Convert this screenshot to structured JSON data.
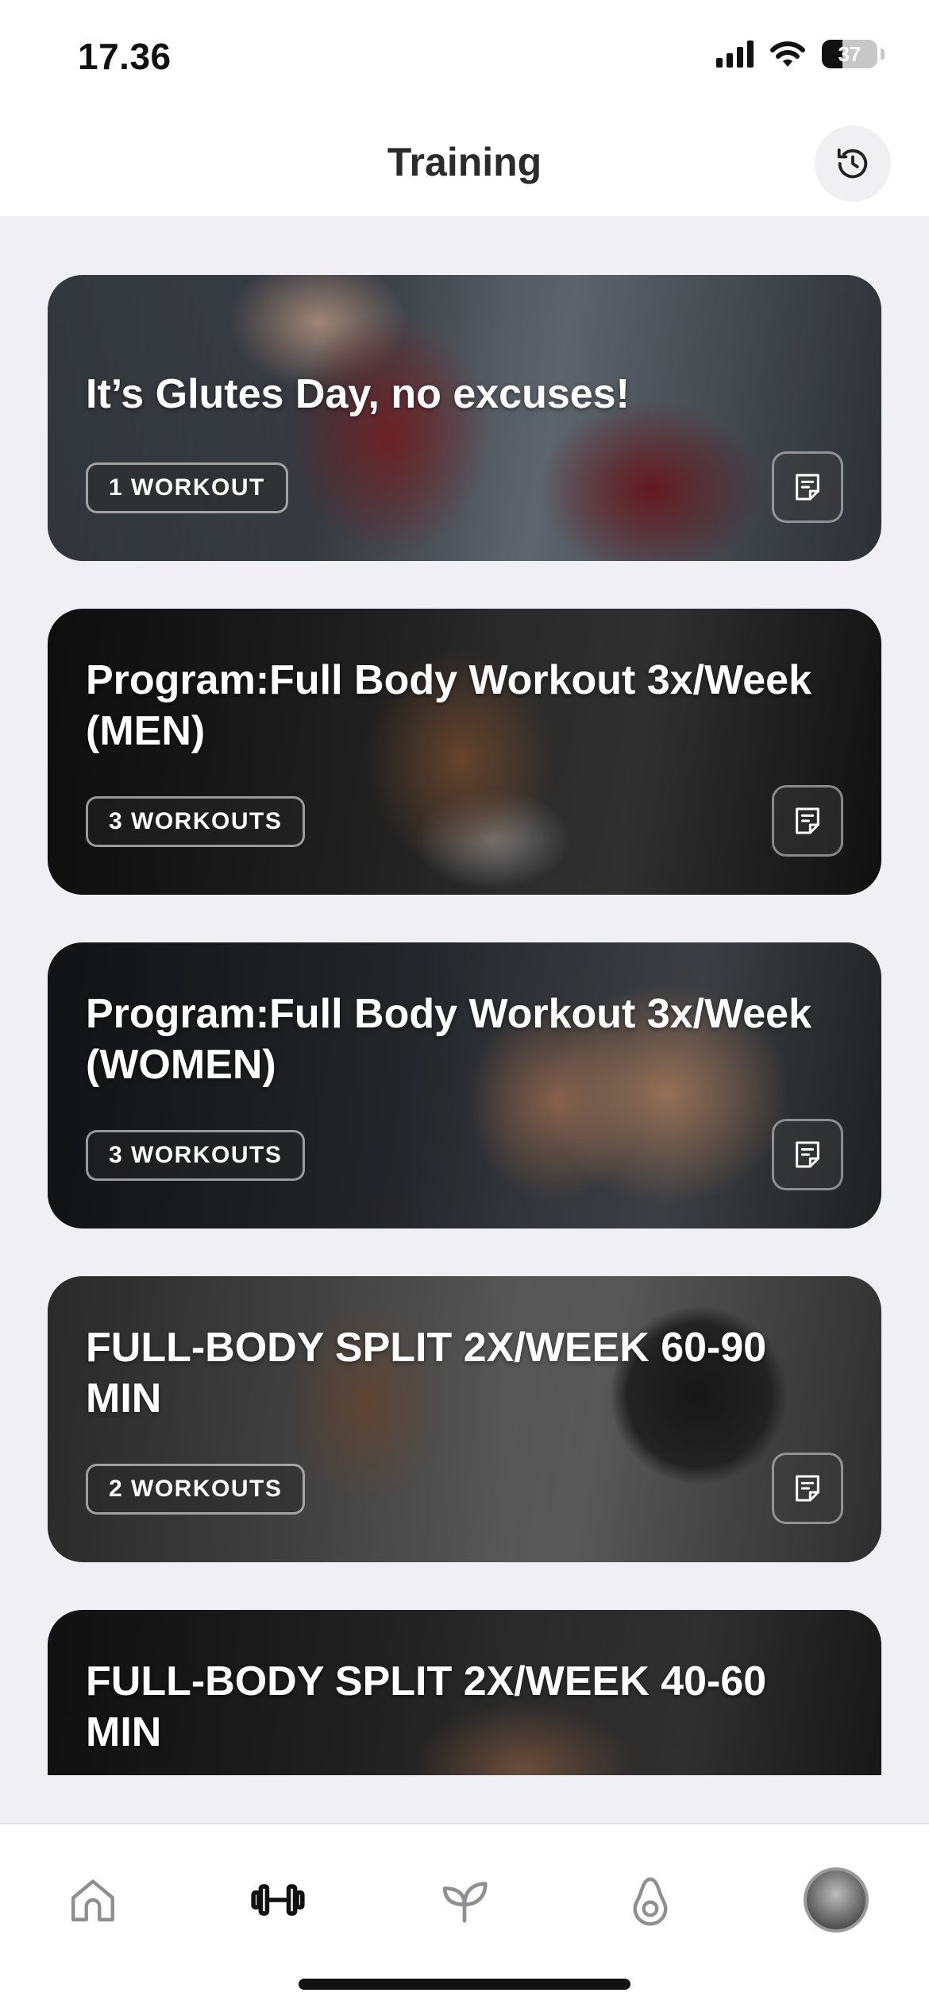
{
  "status_bar": {
    "time": "17.36",
    "battery": "37"
  },
  "header": {
    "title": "Training"
  },
  "cards": [
    {
      "title": "It’s Glutes Day, no excuses!",
      "badge": "1 WORKOUT"
    },
    {
      "title": "Program:Full Body Workout 3x/Week (MEN)",
      "badge": "3 WORKOUTS"
    },
    {
      "title": "Program:Full Body Workout 3x/Week (WOMEN)",
      "badge": "3 WORKOUTS"
    },
    {
      "title": "FULL-BODY SPLIT 2X/WEEK 60-90 MIN",
      "badge": "2 WORKOUTS"
    },
    {
      "title": "FULL-BODY SPLIT 2X/WEEK 40-60 MIN"
    }
  ],
  "tabbar": {
    "tabs": [
      "home-icon",
      "dumbbell-icon",
      "leaf-icon",
      "avocado-icon",
      "profile-avatar"
    ],
    "active_color": "#111111",
    "inactive_color": "#8e8e93"
  }
}
